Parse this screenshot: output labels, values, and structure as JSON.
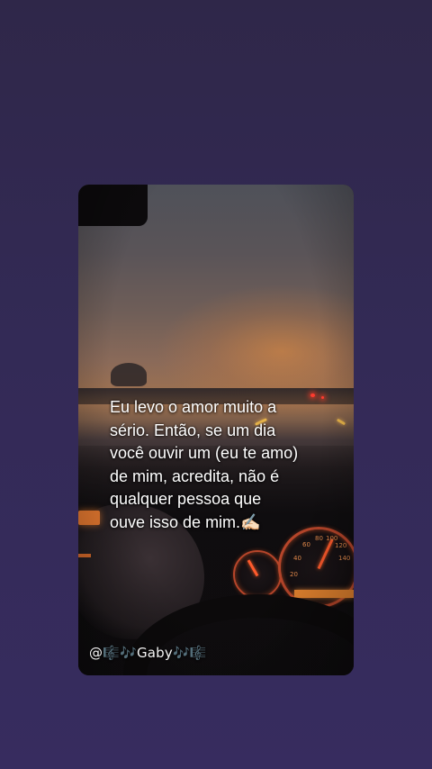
{
  "story": {
    "quote": "Eu levo o amor muito a\nsério. Então, se um dia\nvocê ouvir um (eu te amo)\nde mim, acredita, não é\nqualquer pessoa que\nouve isso de mim.✍🏻",
    "username": "@🎼🎶Gaby🎶🎼"
  },
  "dashboard": {
    "gauge_ticks": [
      "20",
      "40",
      "60",
      "80",
      "100",
      "120",
      "140"
    ]
  },
  "colors": {
    "page_background": "#332a56",
    "text": "#ffffff",
    "accent_orange": "#e5842f"
  }
}
